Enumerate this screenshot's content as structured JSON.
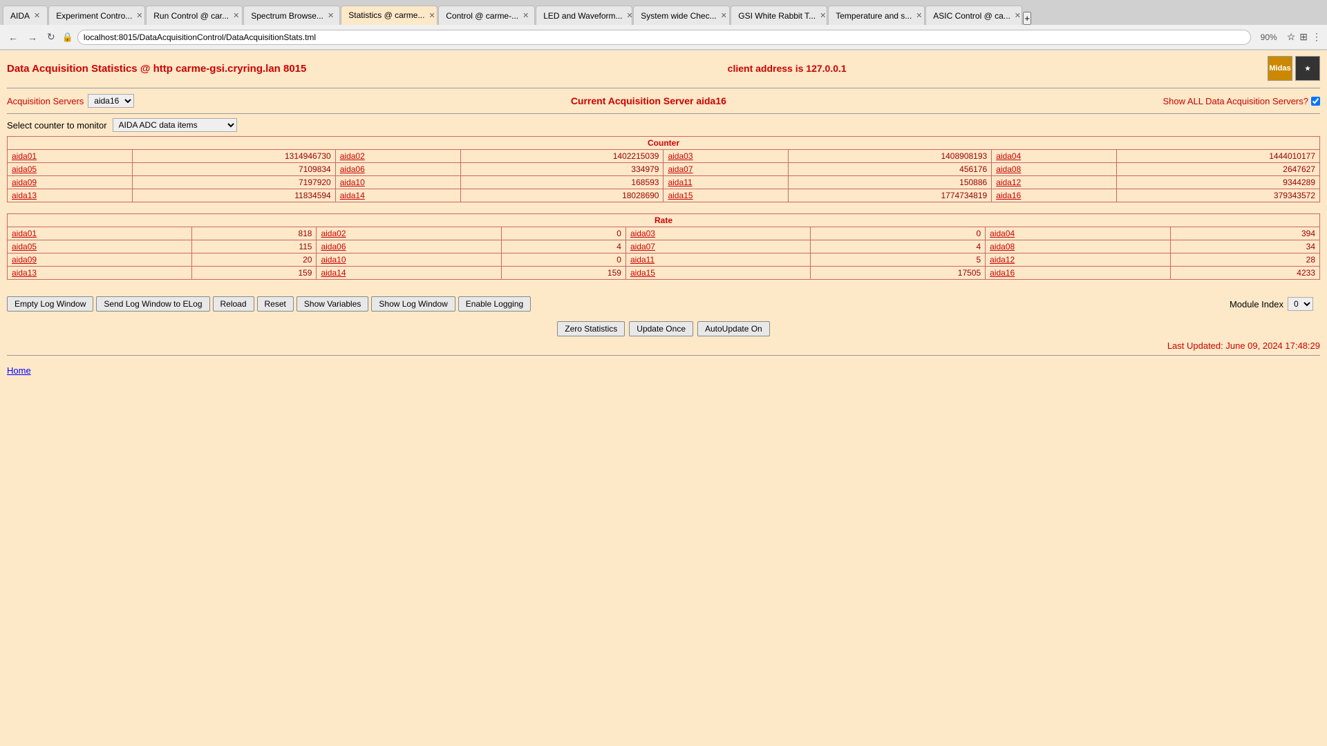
{
  "browser": {
    "tabs": [
      {
        "label": "AIDA",
        "active": false,
        "closeable": true
      },
      {
        "label": "Experiment Contro...",
        "active": false,
        "closeable": true
      },
      {
        "label": "Run Control @ car...",
        "active": false,
        "closeable": true
      },
      {
        "label": "Spectrum Browse...",
        "active": false,
        "closeable": true
      },
      {
        "label": "Statistics @ carme...",
        "active": true,
        "closeable": true
      },
      {
        "label": "Control @ carme-...",
        "active": false,
        "closeable": true
      },
      {
        "label": "LED and Waveform...",
        "active": false,
        "closeable": true
      },
      {
        "label": "System wide Chec...",
        "active": false,
        "closeable": true
      },
      {
        "label": "GSI White Rabbit T...",
        "active": false,
        "closeable": true
      },
      {
        "label": "Temperature and s...",
        "active": false,
        "closeable": true
      },
      {
        "label": "ASIC Control @ ca...",
        "active": false,
        "closeable": true
      }
    ],
    "url": "localhost:8015/DataAcquisitionControl/DataAcquisitionStats.tml",
    "zoom": "90%"
  },
  "page": {
    "title": "Data Acquisition Statistics @ http carme-gsi.cryring.lan 8015",
    "client_address_label": "client address is 127.0.0.1",
    "acquisition_servers_label": "Acquisition Servers",
    "selected_server": "aida16",
    "current_server_label": "Current Acquisition Server aida16",
    "show_all_label": "Show ALL Data Acquisition Servers?",
    "counter_select_label": "Select counter to monitor",
    "counter_option": "AIDA ADC data items",
    "counter_section": "Counter",
    "rate_section": "Rate",
    "counter_rows": [
      {
        "name": "aida01",
        "value": "1314946730",
        "name2": "aida02",
        "value2": "1402215039",
        "name3": "aida03",
        "value3": "1408908193",
        "name4": "aida04",
        "value4": "1444010177"
      },
      {
        "name": "aida05",
        "value": "7109834",
        "name2": "aida06",
        "value2": "334979",
        "name3": "aida07",
        "value3": "456176",
        "name4": "aida08",
        "value4": "2647627"
      },
      {
        "name": "aida09",
        "value": "7197920",
        "name2": "aida10",
        "value2": "168593",
        "name3": "aida11",
        "value3": "150886",
        "name4": "aida12",
        "value4": "9344289"
      },
      {
        "name": "aida13",
        "value": "11834594",
        "name2": "aida14",
        "value2": "18028690",
        "name3": "aida15",
        "value3": "1774734819",
        "name4": "aida16",
        "value4": "379343572"
      }
    ],
    "rate_rows": [
      {
        "name": "aida01",
        "value": "818",
        "name2": "aida02",
        "value2": "0",
        "name3": "aida03",
        "value3": "0",
        "name4": "aida04",
        "value4": "394"
      },
      {
        "name": "aida05",
        "value": "115",
        "name2": "aida06",
        "value2": "4",
        "name3": "aida07",
        "value3": "4",
        "name4": "aida08",
        "value4": "34"
      },
      {
        "name": "aida09",
        "value": "20",
        "name2": "aida10",
        "value2": "0",
        "name3": "aida11",
        "value3": "5",
        "name4": "aida12",
        "value4": "28"
      },
      {
        "name": "aida13",
        "value": "159",
        "name2": "aida14",
        "value2": "159",
        "name3": "aida15",
        "value3": "17505",
        "name4": "aida16",
        "value4": "4233"
      }
    ],
    "buttons": {
      "empty_log": "Empty Log Window",
      "send_log": "Send Log Window to ELog",
      "reload": "Reload",
      "reset": "Reset",
      "show_variables": "Show Variables",
      "show_log": "Show Log Window",
      "enable_logging": "Enable Logging",
      "zero_statistics": "Zero Statistics",
      "update_once": "Update Once",
      "autoupdate": "AutoUpdate On",
      "module_index_label": "Module Index",
      "module_index_value": "0"
    },
    "last_updated": "Last Updated: June 09, 2024 17:48:29",
    "home_link": "Home"
  }
}
